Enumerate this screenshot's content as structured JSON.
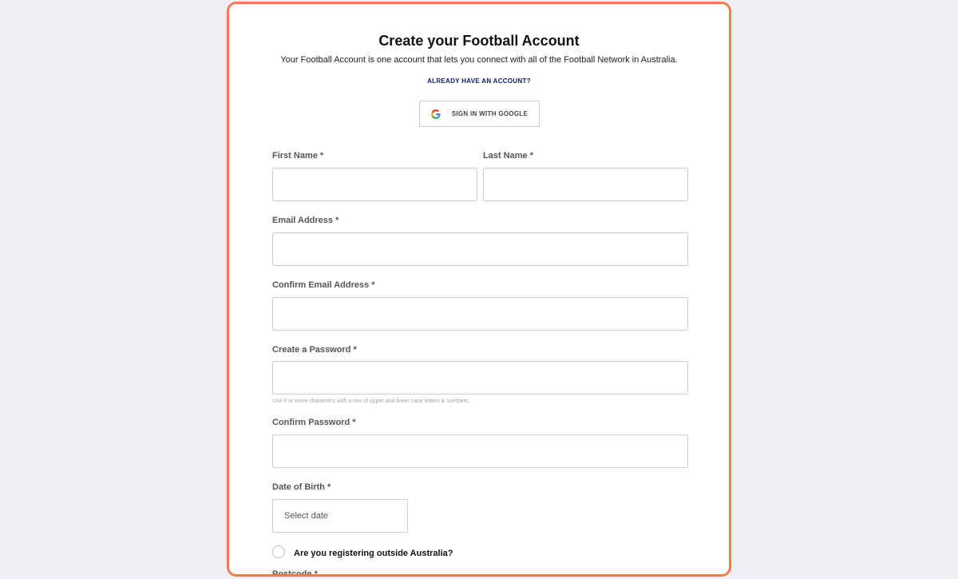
{
  "form": {
    "title": "Create your Football Account",
    "subtitle": "Your Football Account is one account that lets you connect with all of the Football Network in Australia.",
    "already_link": "ALREADY HAVE AN ACCOUNT?",
    "google_button": "SIGN IN WITH GOOGLE",
    "first_name_label": "First Name *",
    "last_name_label": "Last Name *",
    "email_label": "Email Address *",
    "confirm_email_label": "Confirm Email Address *",
    "password_label": "Create a Password *",
    "password_hint": "Use 8 or more characters with a mix of upper and lower case letters & numbers.",
    "confirm_password_label": "Confirm Password *",
    "dob_label": "Date of Birth *",
    "dob_placeholder": "Select date",
    "outside_label": "Are you registering outside Australia?",
    "postcode_label": "Postcode *"
  },
  "colors": {
    "card_border": "#f07c4f",
    "link": "#0d1b6e",
    "background": "#eff0f3"
  },
  "icons": {
    "google": "google-logo-icon"
  }
}
